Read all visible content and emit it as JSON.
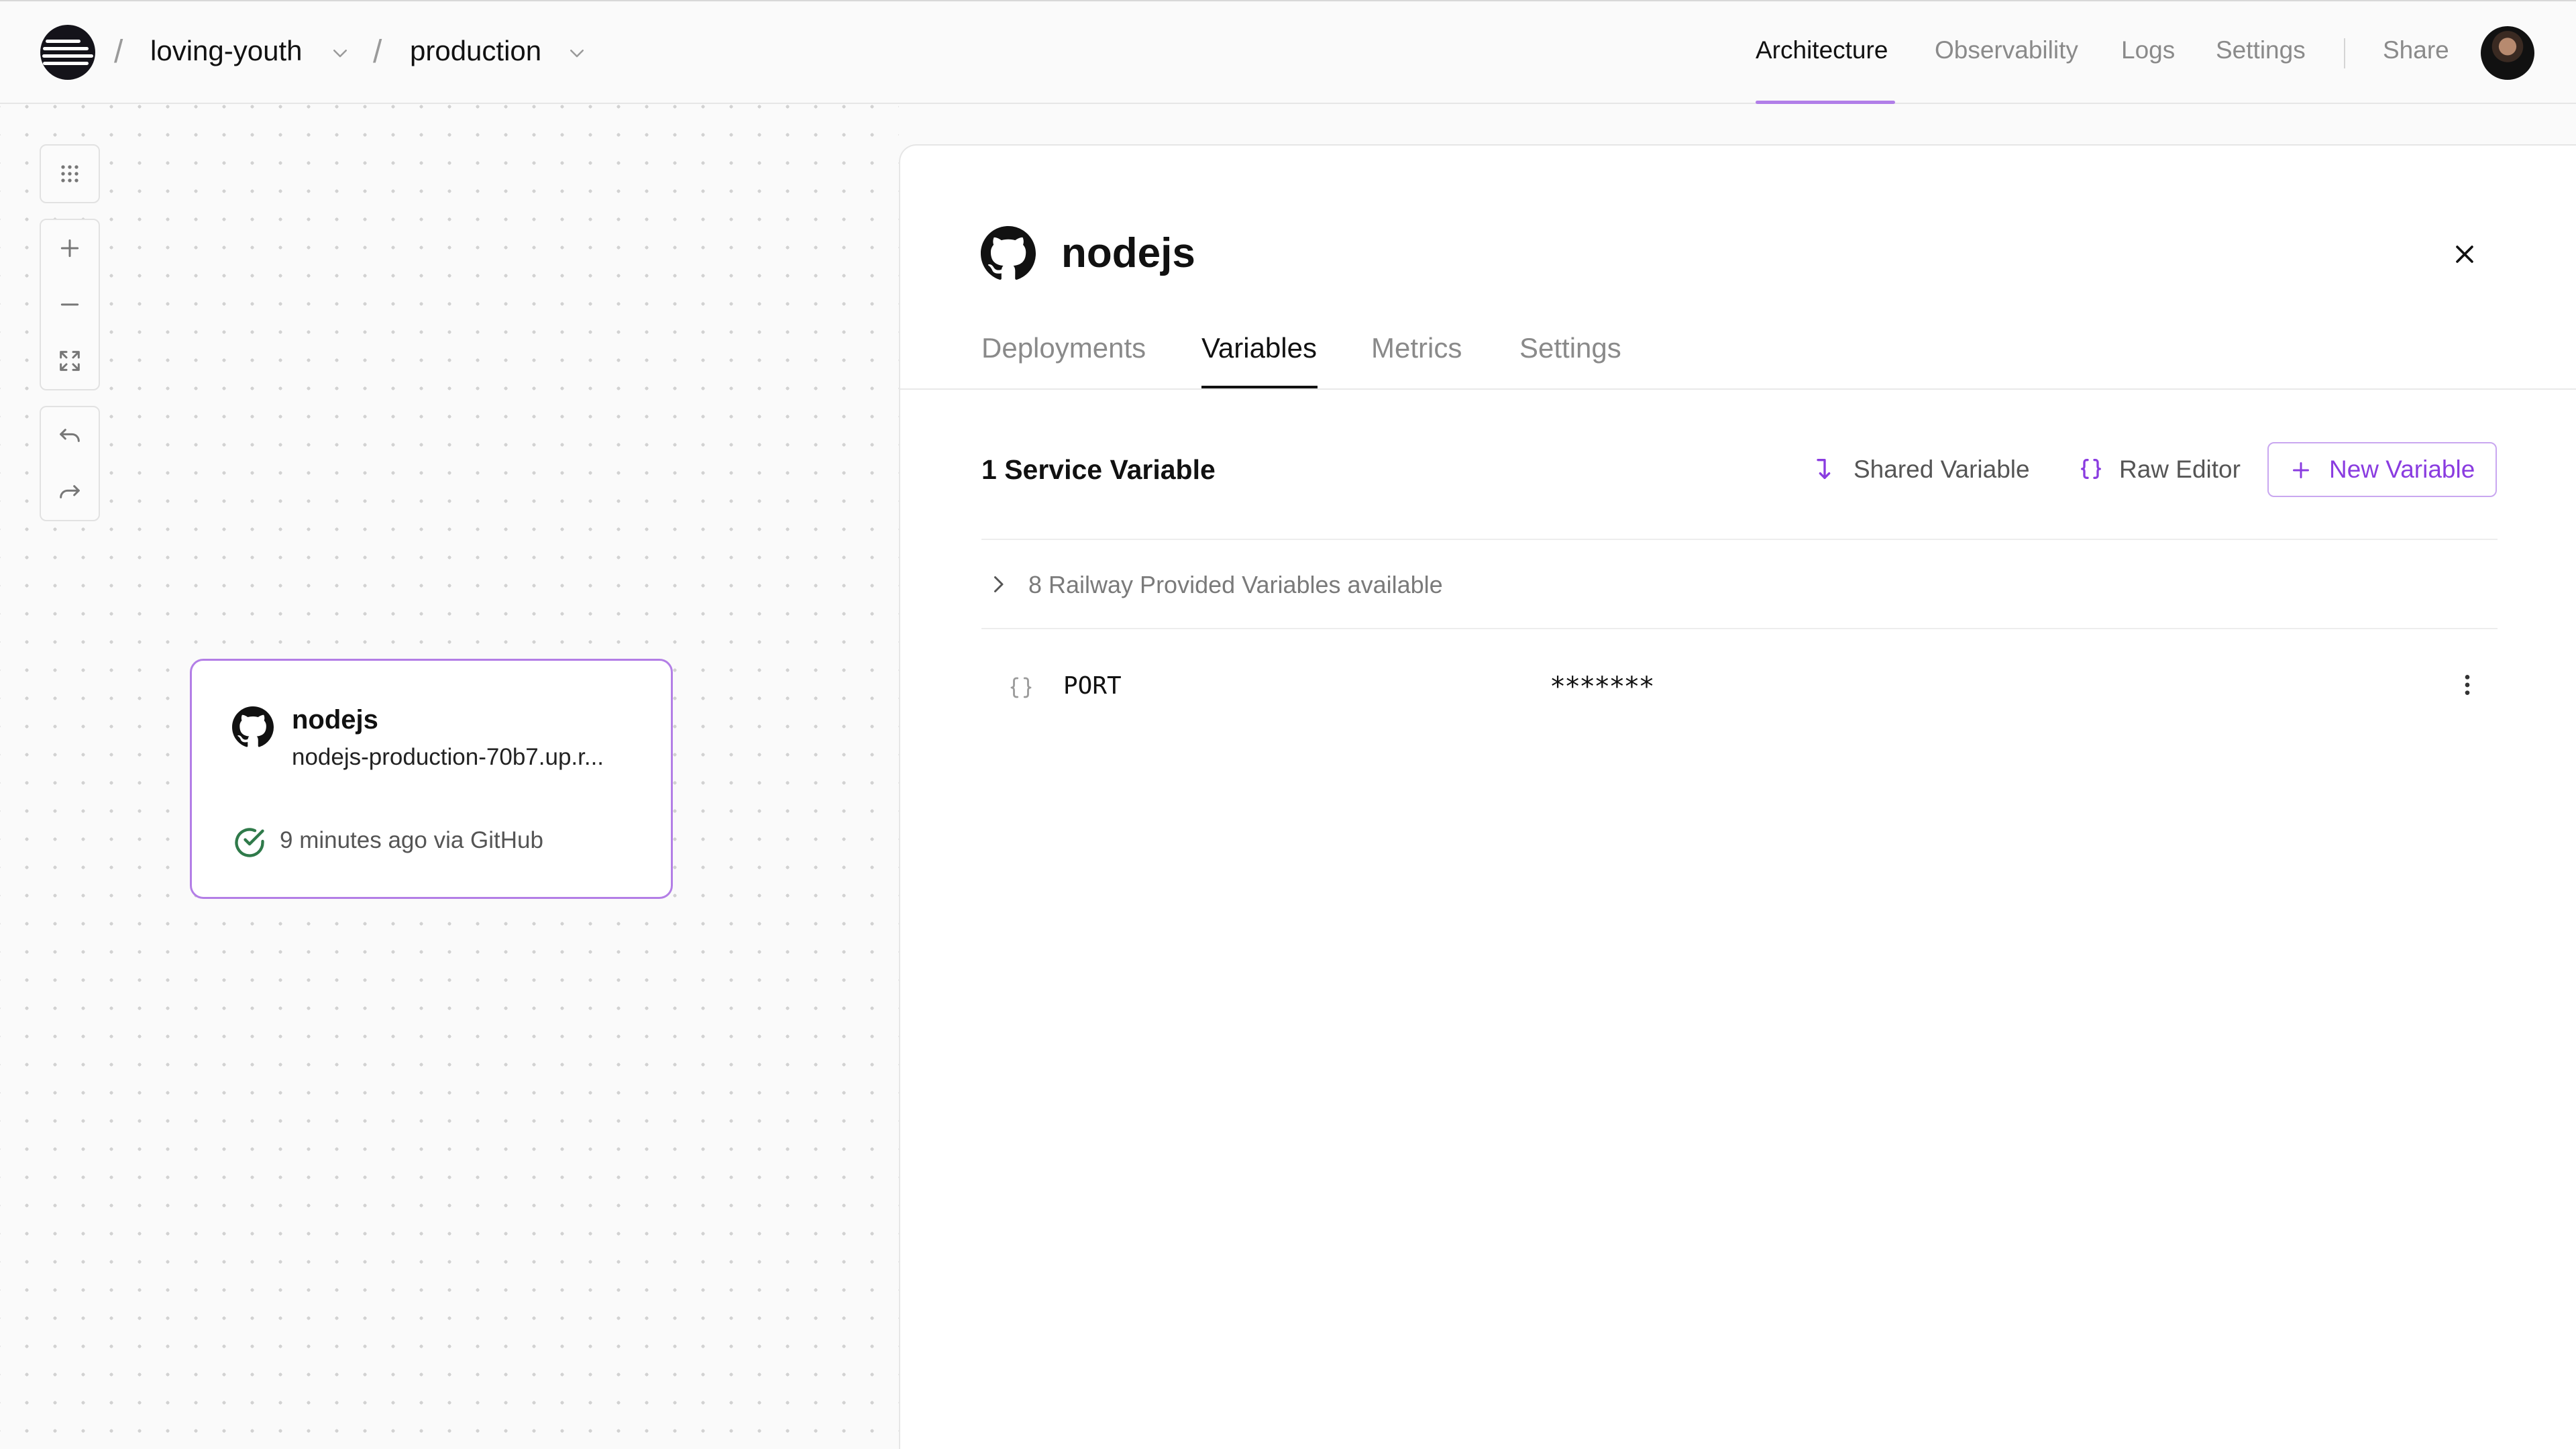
{
  "header": {
    "project_name": "loving-youth",
    "environment_name": "production",
    "nav": [
      "Architecture",
      "Observability",
      "Logs",
      "Settings"
    ],
    "share_label": "Share"
  },
  "canvas": {
    "service_card": {
      "name": "nodejs",
      "url": "nodejs-production-70b7.up.r...",
      "status": "9 minutes ago via GitHub"
    }
  },
  "panel": {
    "title": "nodejs",
    "tabs": [
      "Deployments",
      "Variables",
      "Metrics",
      "Settings"
    ],
    "active_tab": "Variables",
    "section_title": "1 Service Variable",
    "actions": {
      "shared_variable": "Shared Variable",
      "raw_editor": "Raw Editor",
      "new_variable": "New Variable"
    },
    "railway_provided": "8 Railway Provided Variables available",
    "variables": [
      {
        "name": "PORT",
        "value": "*******"
      }
    ]
  },
  "colors": {
    "accent": "#8a3ce0",
    "accent_border": "#b37ee6",
    "success": "#2f7a4a"
  }
}
